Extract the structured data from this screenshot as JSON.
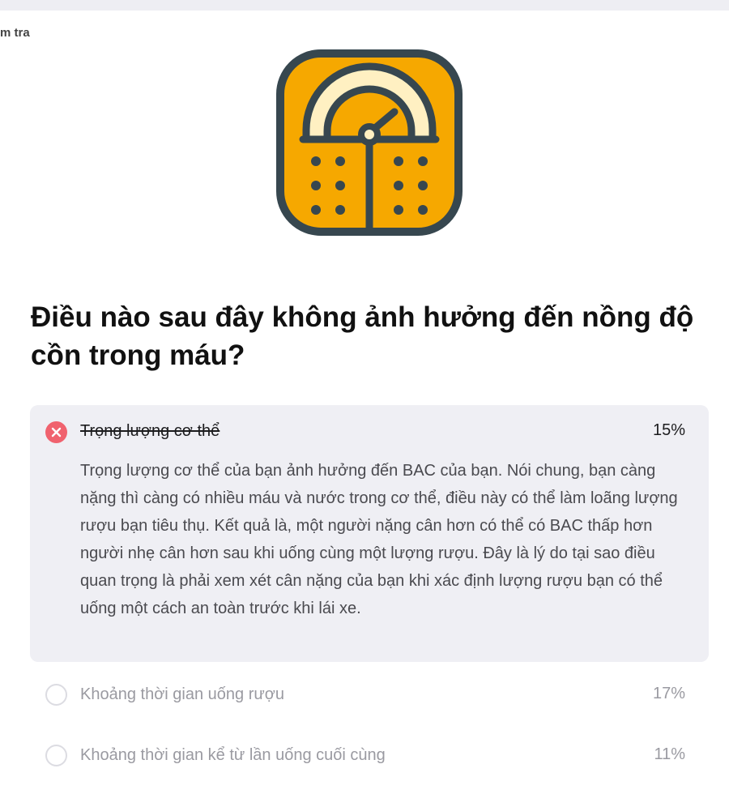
{
  "breadcrumb": "m tra",
  "illustration": {
    "icon": "weighing-scale-icon",
    "colors": {
      "body": "#f6a800",
      "outline": "#37474f",
      "dial": "#fff0c2"
    }
  },
  "question": "Điều nào sau đây không ảnh hưởng đến nồng độ cồn trong máu?",
  "options": [
    {
      "label": "Trọng lượng cơ thể",
      "percent": "15%",
      "state": "wrong",
      "explanation": "Trọng lượng cơ thể của bạn ảnh hưởng đến BAC của bạn. Nói chung, bạn càng nặng thì càng có nhiều máu và nước trong cơ thể, điều này có thể làm loãng lượng rượu bạn tiêu thụ. Kết quả là, một người nặng cân hơn có thể có BAC thấp hơn người nhẹ cân hơn sau khi uống cùng một lượng rượu. Đây là lý do tại sao điều quan trọng là phải xem xét cân nặng của bạn khi xác định lượng rượu bạn có thể uống một cách an toàn trước khi lái xe."
    },
    {
      "label": "Khoảng thời gian uống rượu",
      "percent": "17%",
      "state": "unselected"
    },
    {
      "label": "Khoảng thời gian kể từ lần uống cuối cùng",
      "percent": "11%",
      "state": "unselected"
    }
  ],
  "colors": {
    "wrong": "#f0626e",
    "card_bg": "#efeff4",
    "muted_text": "#9a9aa1"
  }
}
